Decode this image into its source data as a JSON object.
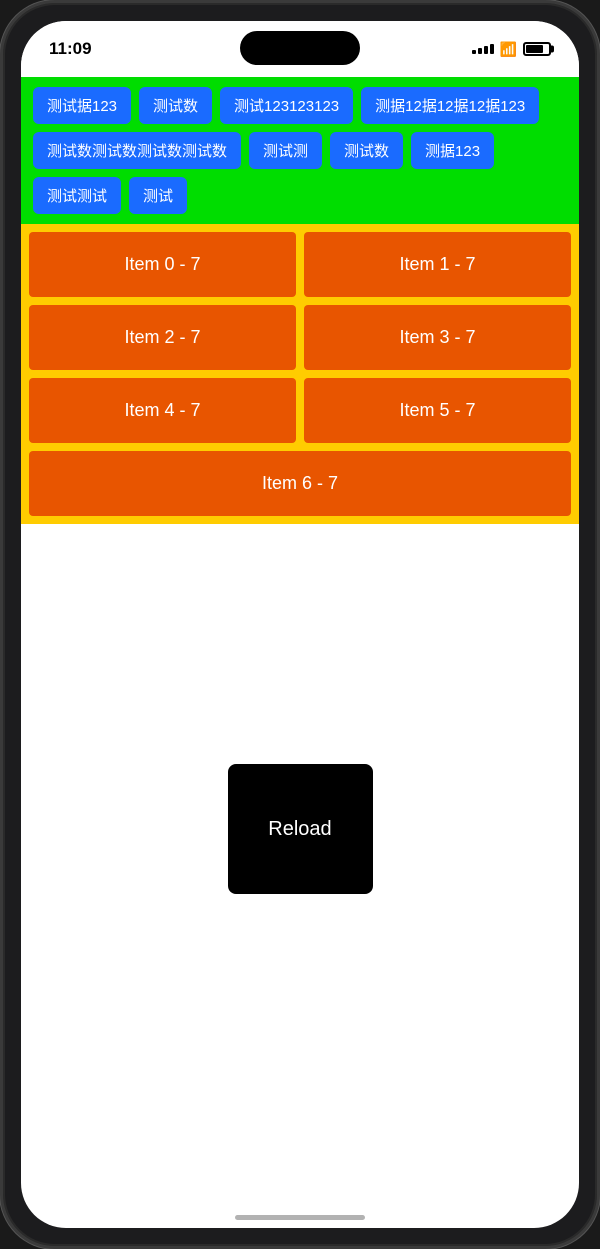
{
  "statusBar": {
    "time": "11:09",
    "batteryLevel": "75"
  },
  "tags": {
    "chips": [
      "测试据123",
      "测试数",
      "测试123123123",
      "测据12据12据12据123",
      "测试数测试数测试数测试数",
      "测试测",
      "测试数",
      "测据123",
      "测试测试",
      "测试"
    ]
  },
  "gridSection": {
    "items": [
      {
        "label": "Item 0 - 7"
      },
      {
        "label": "Item 1 - 7"
      },
      {
        "label": "Item 2 - 7"
      },
      {
        "label": "Item 3 - 7"
      },
      {
        "label": "Item 4 - 7"
      },
      {
        "label": "Item 5 - 7"
      },
      {
        "label": "Item 6 - 7"
      }
    ]
  },
  "reloadButton": {
    "label": "Reload"
  }
}
